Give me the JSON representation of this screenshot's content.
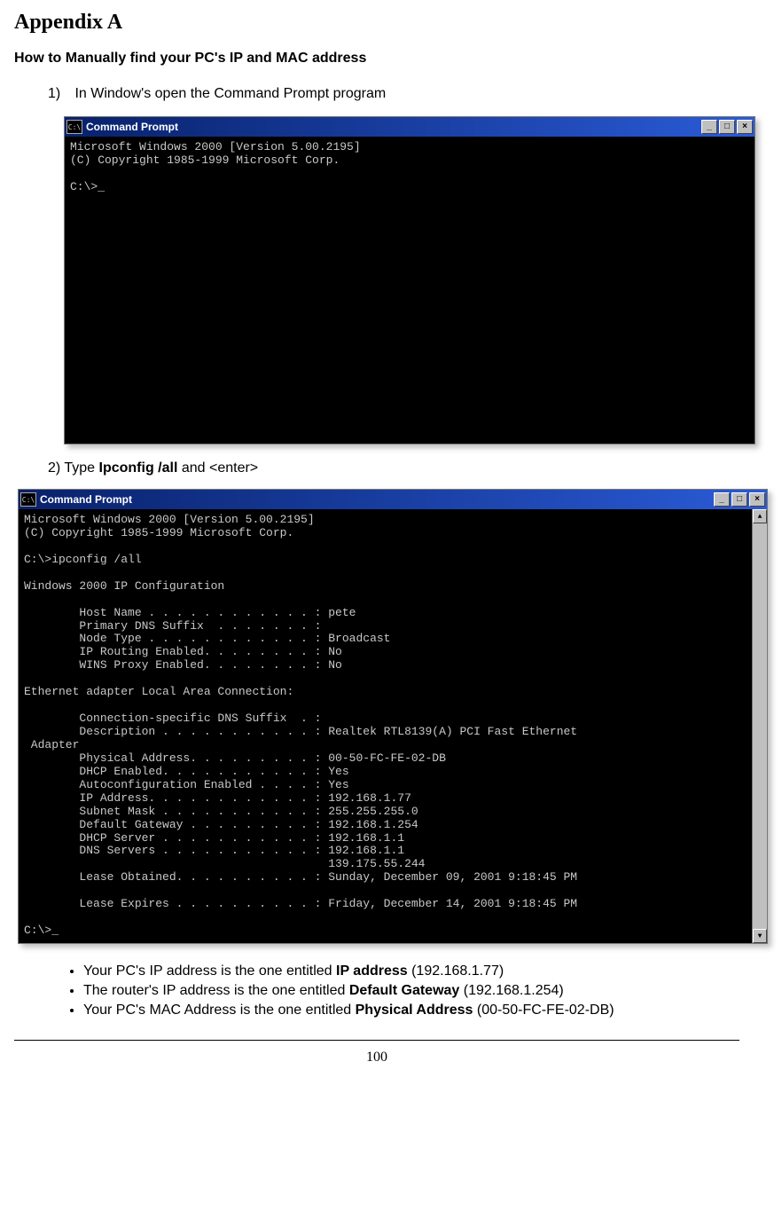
{
  "heading": "Appendix A",
  "subheading": "How to Manually find your PC's IP and MAC address",
  "step1_num": "1)",
  "step1_text": "In Window's open the Command Prompt program",
  "cmd1": {
    "title": "Command Prompt",
    "icon_glyph": "C:\\",
    "body": "Microsoft Windows 2000 [Version 5.00.2195]\n(C) Copyright 1985-1999 Microsoft Corp.\n\nC:\\>_"
  },
  "step2_prefix": "2) Type ",
  "step2_bold": "Ipconfig /all",
  "step2_suffix": " and <enter>",
  "cmd2": {
    "title": "Command Prompt",
    "icon_glyph": "C:\\",
    "body": "Microsoft Windows 2000 [Version 5.00.2195]\n(C) Copyright 1985-1999 Microsoft Corp.\n\nC:\\>ipconfig /all\n\nWindows 2000 IP Configuration\n\n        Host Name . . . . . . . . . . . . : pete\n        Primary DNS Suffix  . . . . . . . :\n        Node Type . . . . . . . . . . . . : Broadcast\n        IP Routing Enabled. . . . . . . . : No\n        WINS Proxy Enabled. . . . . . . . : No\n\nEthernet adapter Local Area Connection:\n\n        Connection-specific DNS Suffix  . :\n        Description . . . . . . . . . . . : Realtek RTL8139(A) PCI Fast Ethernet\n Adapter\n        Physical Address. . . . . . . . . : 00-50-FC-FE-02-DB\n        DHCP Enabled. . . . . . . . . . . : Yes\n        Autoconfiguration Enabled . . . . : Yes\n        IP Address. . . . . . . . . . . . : 192.168.1.77\n        Subnet Mask . . . . . . . . . . . : 255.255.255.0\n        Default Gateway . . . . . . . . . : 192.168.1.254\n        DHCP Server . . . . . . . . . . . : 192.168.1.1\n        DNS Servers . . . . . . . . . . . : 192.168.1.1\n                                            139.175.55.244\n        Lease Obtained. . . . . . . . . . : Sunday, December 09, 2001 9:18:45 PM\n\n        Lease Expires . . . . . . . . . . : Friday, December 14, 2001 9:18:45 PM\n\nC:\\>_"
  },
  "bullets": {
    "b1_pre": "Your PC's IP address is the one entitled ",
    "b1_bold": "IP address",
    "b1_post": " (192.168.1.77)",
    "b2_pre": "The router's IP address is the one entitled ",
    "b2_bold": "Default Gateway",
    "b2_post": " (192.168.1.254)",
    "b3_pre": "Your PC's MAC Address is the one entitled ",
    "b3_bold": "Physical Address",
    "b3_post": "  (00-50-FC-FE-02-DB)"
  },
  "win_controls": {
    "min": "_",
    "max": "□",
    "close": "×",
    "up": "▲",
    "down": "▼"
  },
  "page_number": "100"
}
